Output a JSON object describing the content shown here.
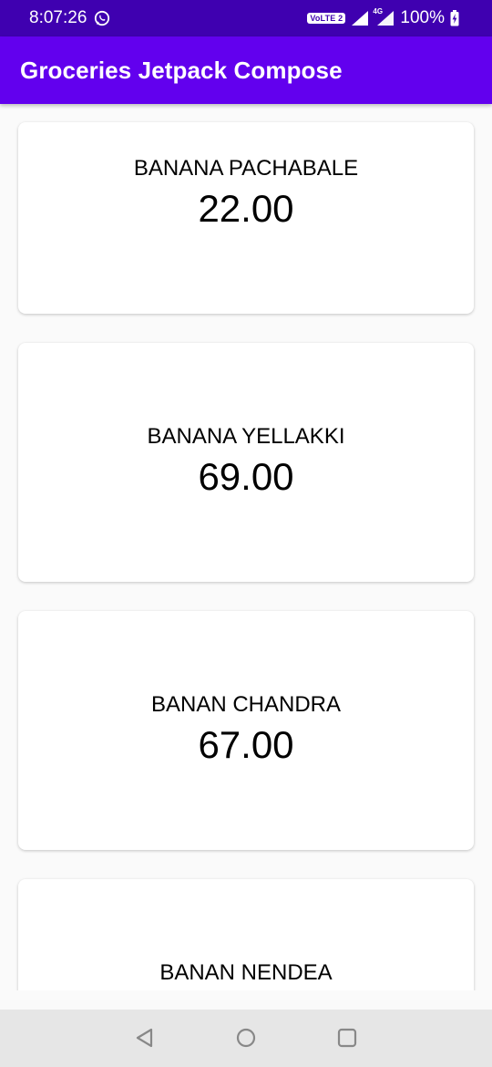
{
  "status_bar": {
    "time": "8:07:26",
    "network_badge": "VoLTE 2",
    "network_type": "4G",
    "battery": "100%",
    "icons": [
      "whatsapp-icon",
      "signal-icon",
      "signal-4g-icon",
      "battery-charging-icon"
    ]
  },
  "app_bar": {
    "title": "Groceries Jetpack Compose"
  },
  "items": [
    {
      "name": "BANANA PACHABALE",
      "price": "22.00"
    },
    {
      "name": "BANANA YELLAKKI",
      "price": "69.00"
    },
    {
      "name": "BANAN CHANDRA",
      "price": "67.00"
    },
    {
      "name": "BANAN NENDEA",
      "price": ""
    }
  ],
  "nav_bar": {
    "icons": [
      "back-icon",
      "home-icon",
      "recents-icon"
    ]
  },
  "colors": {
    "status_bar": "#3f00b0",
    "app_bar": "#6200ee",
    "background": "#fafafa",
    "nav_bar": "#e6e6e6"
  }
}
